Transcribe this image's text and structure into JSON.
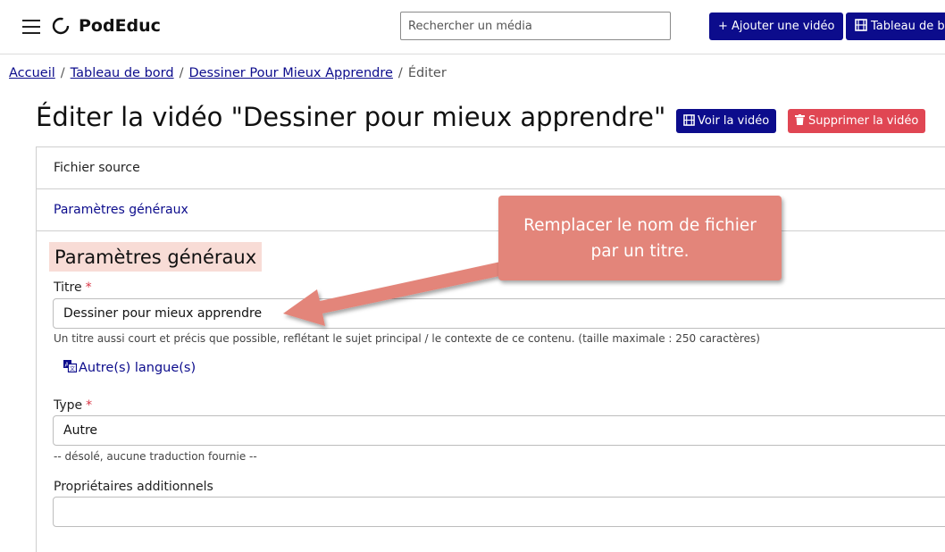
{
  "header": {
    "brand": "PodEduc",
    "search_placeholder": "Rechercher un média",
    "add_video_label": "+ Ajouter une vidéo",
    "dashboard_label": "Tableau de bord"
  },
  "breadcrumb": {
    "items": [
      "Accueil",
      "Tableau de bord",
      "Dessiner Pour Mieux Apprendre"
    ],
    "current": "Éditer"
  },
  "page": {
    "title": "Éditer la vidéo \"Dessiner pour mieux apprendre\"",
    "view_label": "Voir la vidéo",
    "delete_label": "Supprimer la vidéo"
  },
  "panels": {
    "source": "Fichier source",
    "general": "Paramètres généraux"
  },
  "form": {
    "section_title": "Paramètres généraux",
    "title_label": "Titre",
    "required_mark": "*",
    "title_value": "Dessiner pour mieux apprendre",
    "title_help": "Un titre aussi court et précis que possible, reflétant le sujet principal / le contexte de ce contenu. (taille maximale : 250 caractères)",
    "other_languages": "Autre(s) langue(s)",
    "type_label": "Type",
    "type_value": "Autre",
    "type_help": "-- désolé, aucune traduction fournie --",
    "owners_label": "Propriétaires additionnels",
    "owners_value": ""
  },
  "annotation": {
    "line1": "Remplacer le nom de fichier",
    "line2": "par un titre.",
    "color": "#e3857a"
  },
  "colors": {
    "primary": "#0c0c8c",
    "danger": "#e04653",
    "highlight": "#f8dcd6"
  }
}
